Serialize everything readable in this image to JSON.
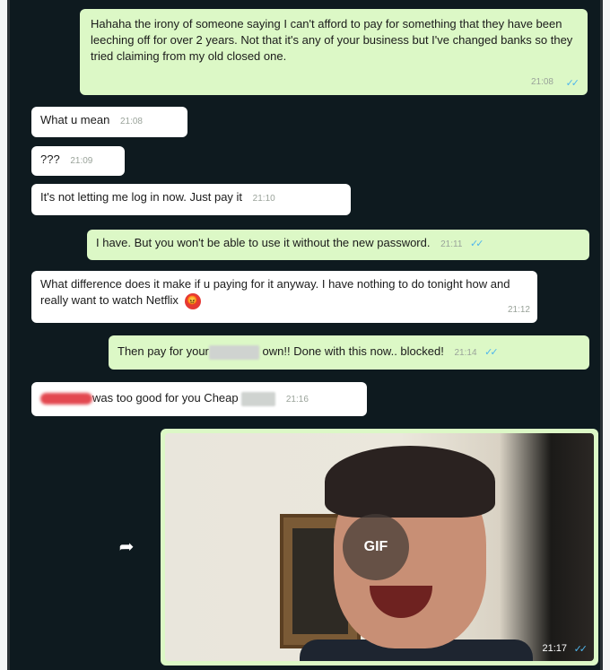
{
  "messages": [
    {
      "id": "m1",
      "dir": "out",
      "text": "Hahaha the irony of someone saying I can't afford to pay for something that they have been leeching off for over 2 years. Not that it's any of your business but I've changed banks so they tried claiming from my old closed one.",
      "time": "21:08",
      "ticks": "✓✓"
    },
    {
      "id": "m2",
      "dir": "in",
      "text": "What u mean",
      "time": "21:08"
    },
    {
      "id": "m3",
      "dir": "in",
      "text": "???",
      "time": "21:09"
    },
    {
      "id": "m4",
      "dir": "in",
      "text": "It's not letting me log in now. Just pay it",
      "time": "21:10"
    },
    {
      "id": "m5",
      "dir": "out",
      "text": "I have. But you won't be able to use it without the new password.",
      "time": "21:11",
      "ticks": "✓✓"
    },
    {
      "id": "m6",
      "dir": "in",
      "text": "What difference does it make if u paying for it anyway. I have nothing to do tonight how and really want to watch Netflix",
      "emoji": "😡",
      "time": "21:12"
    },
    {
      "id": "m7",
      "dir": "out",
      "text_before": "Then pay for your",
      "text_after": "own!! Done with this now.. blocked!",
      "time": "21:14",
      "ticks": "✓✓"
    },
    {
      "id": "m8",
      "dir": "in",
      "text_before": "was too good for you Cheap",
      "time": "21:16"
    },
    {
      "id": "m9",
      "dir": "out",
      "type": "gif",
      "badge": "GIF",
      "time": "21:17",
      "ticks": "✓✓"
    }
  ],
  "icons": {
    "forward": "forward-arrow-icon",
    "forward_glyph": "➦",
    "angry": "angry-face-emoji-icon",
    "ticks": "double-check-icon"
  },
  "colors": {
    "background": "#0e1a1f",
    "outgoing": "#dcf8c6",
    "incoming": "#ffffff",
    "tick_blue": "#4fb6ec"
  }
}
